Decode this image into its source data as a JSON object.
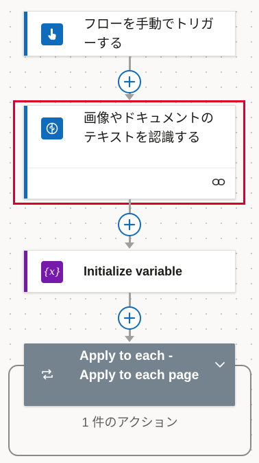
{
  "flow": {
    "trigger": {
      "title": "フローを手動でトリガーする",
      "icon": "hand-tap-icon",
      "color": "#0f6cbd"
    },
    "ocr_action": {
      "title": "画像やドキュメントのテキストを認識する",
      "icon": "ai-brain-icon",
      "footer_icon": "link-icon",
      "color": "#0f6cbd"
    },
    "init_variable": {
      "title": "Initialize variable",
      "icon": "variable-icon",
      "icon_text": "{x}",
      "color": "#7719aa"
    },
    "apply_to_each": {
      "title": "Apply to each - Apply to each page",
      "icon": "loop-icon",
      "chevron_icon": "chevron-down-icon",
      "color": "#75838f",
      "body_text": "1 件のアクション"
    }
  },
  "colors": {
    "highlight_border": "#d6002a",
    "connector": "#a19f9d",
    "add_button": "#0f6cbd"
  }
}
